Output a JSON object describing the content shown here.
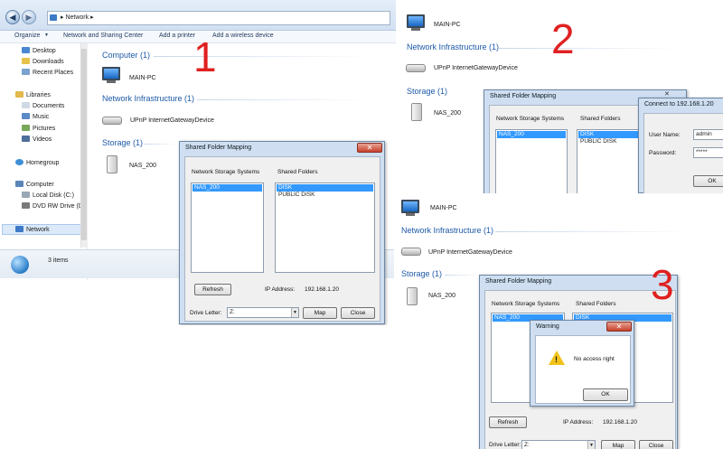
{
  "panel1": {
    "breadcrumb": "Network",
    "toolbar": [
      "Organize",
      "Network and Sharing Center",
      "Add a printer",
      "Add a wireless device"
    ],
    "nav": {
      "favorites": [
        "Desktop",
        "Downloads",
        "Recent Places"
      ],
      "libraries_title": "Libraries",
      "libraries": [
        "Documents",
        "Music",
        "Pictures",
        "Videos"
      ],
      "homegroup": "Homegroup",
      "computer_title": "Computer",
      "computer": [
        "Local Disk (C:)",
        "DVD RW Drive (D"
      ],
      "network": "Network"
    },
    "sections": {
      "computer": "Computer (1)",
      "infra": "Network Infrastructure (1)",
      "storage": "Storage (1)"
    },
    "items": {
      "pc": "MAIN-PC",
      "router": "UPnP InternetGatewayDevice",
      "nas": "NAS_200"
    },
    "status": "3 items",
    "step_number": "1",
    "dialog": {
      "title": "Shared Folder Mapping",
      "col_storage": "Network Storage Systems",
      "col_folders": "Shared Folders",
      "storage_items": [
        "NAS_200"
      ],
      "folder_items": [
        "DISK",
        "PUBLIC DISK"
      ],
      "refresh": "Refresh",
      "ip_label": "IP Address:",
      "ip_value": "192.168.1.20",
      "drive_label": "Drive Letter:",
      "drive_value": "Z:",
      "map": "Map",
      "close": "Close"
    }
  },
  "panel2": {
    "step_number": "2",
    "items": {
      "pc": "MAIN-PC",
      "router": "UPnP InternetGatewayDevice",
      "nas": "NAS_200"
    },
    "sections": {
      "infra": "Network Infrastructure (1)",
      "storage": "Storage (1)"
    },
    "dialog": {
      "title": "Shared Folder Mapping",
      "col_storage": "Network Storage Systems",
      "col_folders": "Shared Folders",
      "storage_items": [
        "NAS_200"
      ],
      "folder_items": [
        "DISK",
        "PUBLIC DISK"
      ]
    },
    "connect": {
      "title": "Connect to 192.168.1.20",
      "user_label": "User Name:",
      "user_value": "admin",
      "pass_label": "Password:",
      "pass_value": "*****",
      "ok": "OK"
    }
  },
  "panel3": {
    "step_number": "3",
    "items": {
      "pc": "MAIN-PC",
      "router": "UPnP InternetGatewayDevice",
      "nas": "NAS_200"
    },
    "sections": {
      "infra": "Network Infrastructure (1)",
      "storage": "Storage (1)"
    },
    "dialog": {
      "title": "Shared Folder Mapping",
      "col_storage": "Network Storage Systems",
      "col_folders": "Shared Folders",
      "storage_items": [
        "NAS_200"
      ],
      "folder_items": [
        "DISK"
      ],
      "refresh": "Refresh",
      "ip_label": "IP Address:",
      "ip_value": "192.168.1.20",
      "drive_label": "Drive Letter:",
      "drive_value": "Z:",
      "map": "Map",
      "close": "Close"
    },
    "warning": {
      "title": "Warning",
      "message": "No access right",
      "ok": "OK"
    }
  },
  "colors": {
    "accent": "#1e5aa8",
    "step_number": "#e02020",
    "selection": "#3399ff"
  }
}
